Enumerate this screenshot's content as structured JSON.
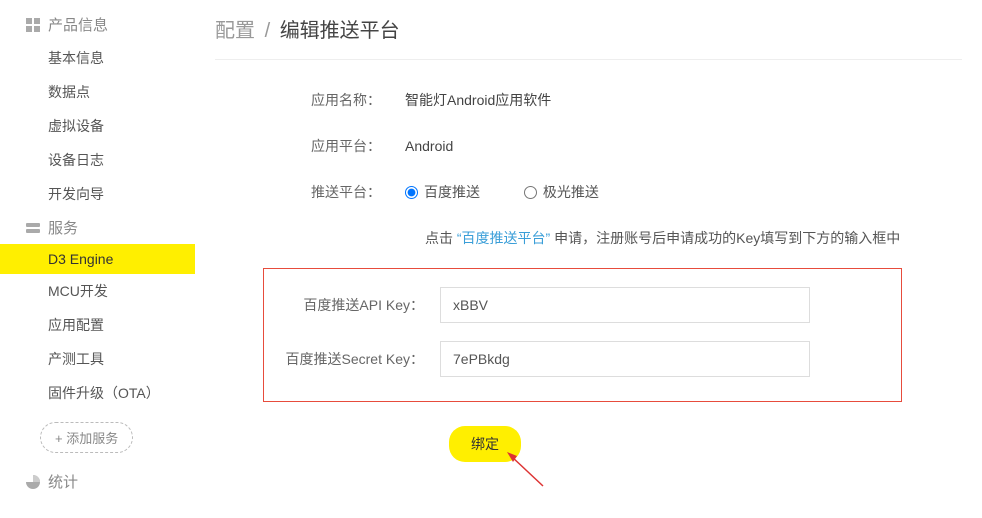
{
  "sidebar": {
    "section1": {
      "title": "产品信息",
      "items": [
        {
          "label": "基本信息"
        },
        {
          "label": "数据点"
        },
        {
          "label": "虚拟设备"
        },
        {
          "label": "设备日志"
        },
        {
          "label": "开发向导"
        }
      ]
    },
    "section2": {
      "title": "服务",
      "items": [
        {
          "label": "D3 Engine",
          "active": true
        },
        {
          "label": "MCU开发"
        },
        {
          "label": "应用配置"
        },
        {
          "label": "产测工具"
        },
        {
          "label": "固件升级（OTA）"
        }
      ],
      "add_label": "+ 添加服务"
    },
    "section3": {
      "title": "统计"
    }
  },
  "breadcrumb": {
    "parent": "配置",
    "sep": "/",
    "current": "编辑推送平台"
  },
  "form": {
    "app_name_lbl": "应用名称：",
    "app_name_val": "智能灯Android应用软件",
    "platform_lbl": "应用平台：",
    "platform_val": "Android",
    "push_lbl": "推送平台：",
    "push_opt1": "百度推送",
    "push_opt2": "极光推送",
    "hint_prefix": "点击",
    "hint_link": "“百度推送平台”",
    "hint_suffix": "申请，注册账号后申请成功的Key填写到下方的输入框中",
    "api_key_lbl": "百度推送API Key：",
    "api_key_val": "xBBV",
    "secret_key_lbl": "百度推送Secret Key：",
    "secret_key_val": "7ePBkdg",
    "submit_label": "绑定"
  }
}
